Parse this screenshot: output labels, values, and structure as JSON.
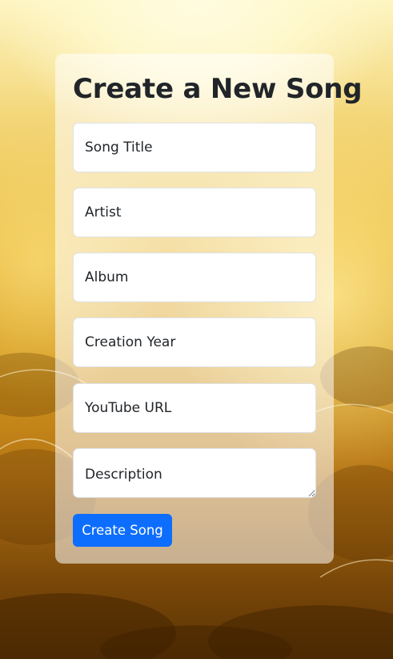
{
  "form": {
    "title": "Create a New Song",
    "fields": {
      "song_title": {
        "placeholder": "Song Title",
        "value": ""
      },
      "artist": {
        "placeholder": "Artist",
        "value": ""
      },
      "album": {
        "placeholder": "Album",
        "value": ""
      },
      "creation_year": {
        "placeholder": "Creation Year",
        "value": ""
      },
      "youtube_url": {
        "placeholder": "YouTube URL",
        "value": ""
      },
      "description": {
        "placeholder": "Description",
        "value": ""
      }
    },
    "submit_label": "Create Song"
  },
  "colors": {
    "button_bg": "#0d6efd",
    "button_text": "#ffffff",
    "card_bg": "rgba(255,255,255,0.55)",
    "title_text": "#212529",
    "background_top": "#fdf4c0",
    "background_bottom": "#5a3305"
  }
}
